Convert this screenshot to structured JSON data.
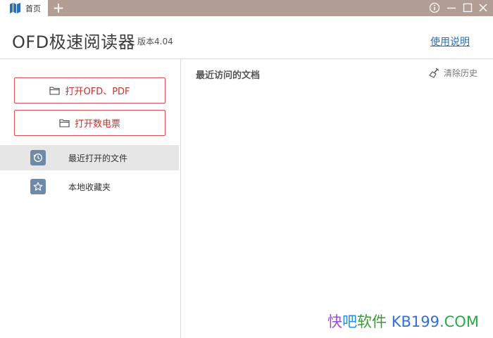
{
  "tab": {
    "label": "首页",
    "add_label": "+"
  },
  "header": {
    "app_title": "OFD极速阅读器",
    "version": "版本4.04",
    "help_link": "使用说明"
  },
  "sidebar": {
    "open_ofd_label": "打开OFD、PDF",
    "open_invoice_label": "打开数电票",
    "items": [
      {
        "label": "最近打开的文件",
        "icon": "history-icon",
        "selected": true
      },
      {
        "label": "本地收藏夹",
        "icon": "star-icon",
        "selected": false
      }
    ]
  },
  "main": {
    "title": "最近访问的文档",
    "clear_history_label": "清除历史"
  },
  "watermark": {
    "part1": "快",
    "part2": "吧",
    "part3": "软件 ",
    "part4": "KB199",
    "part5": ".COM"
  },
  "colors": {
    "titlebar": "#b39e95",
    "accent_red": "#c9302c",
    "nav_icon_bg": "#6e8aa8",
    "link_blue": "#2f6fb0"
  }
}
